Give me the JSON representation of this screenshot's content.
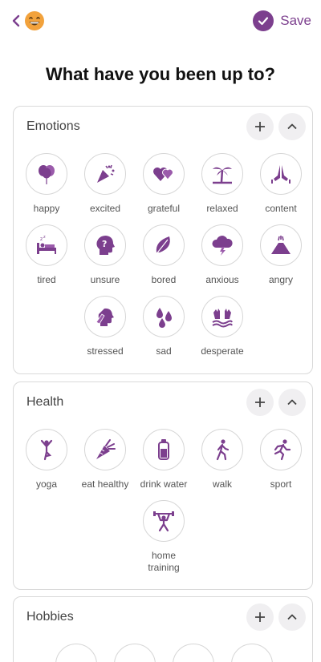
{
  "header": {
    "save_label": "Save",
    "accent": "#7c3f8e"
  },
  "page": {
    "title": "What have you been up to?"
  },
  "sections": [
    {
      "title": "Emotions",
      "items": [
        {
          "label": "happy",
          "icon": "balloons-icon"
        },
        {
          "label": "excited",
          "icon": "party-popper-icon"
        },
        {
          "label": "grateful",
          "icon": "hearts-icon"
        },
        {
          "label": "relaxed",
          "icon": "palm-tree-icon"
        },
        {
          "label": "content",
          "icon": "praying-hands-icon"
        },
        {
          "label": "tired",
          "icon": "bed-sleep-icon"
        },
        {
          "label": "unsure",
          "icon": "head-question-icon"
        },
        {
          "label": "bored",
          "icon": "leaf-icon"
        },
        {
          "label": "anxious",
          "icon": "storm-cloud-icon"
        },
        {
          "label": "angry",
          "icon": "volcano-icon"
        },
        {
          "label": "stressed",
          "icon": "head-hand-icon"
        },
        {
          "label": "sad",
          "icon": "tear-drops-icon"
        },
        {
          "label": "desperate",
          "icon": "raised-hands-icon"
        }
      ]
    },
    {
      "title": "Health",
      "items": [
        {
          "label": "yoga",
          "icon": "yoga-pose-icon"
        },
        {
          "label": "eat healthy",
          "icon": "carrot-icon"
        },
        {
          "label": "drink water",
          "icon": "water-bottle-icon"
        },
        {
          "label": "walk",
          "icon": "walking-person-icon"
        },
        {
          "label": "sport",
          "icon": "running-person-icon"
        },
        {
          "label": "home training",
          "icon": "weightlifter-icon"
        }
      ]
    },
    {
      "title": "Hobbies",
      "items": []
    }
  ]
}
